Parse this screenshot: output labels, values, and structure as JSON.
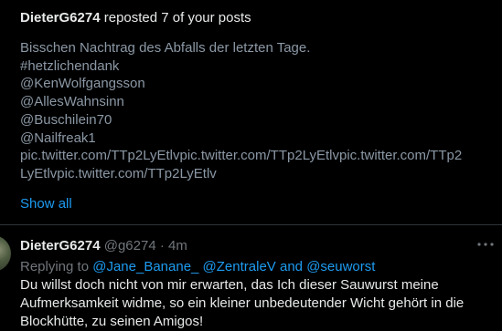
{
  "notification": {
    "user": "DieterG6274",
    "action": "reposted 7 of your posts",
    "preview_lines": [
      "Bisschen Nachtrag  des Abfalls der letzten Tage.",
      "#hetzlichendank",
      "@KenWolfgangsson",
      "@AllesWahnsinn",
      "@Buschilein70",
      "@Nailfreak1",
      "pic.twitter.com/TTp2LyEtlvpic.twitter.com/TTp2LyEtlvpic.twitter.com/TTp2",
      "LyEtlvpic.twitter.com/TTp2LyEtlv"
    ],
    "show_all": "Show all"
  },
  "tweet": {
    "display_name": "DieterG6274",
    "handle": "@g6274",
    "separator": "·",
    "time": "4m",
    "more_icon": "more-horizontal-icon",
    "replying_prefix": "Replying to",
    "mention_1": "@Jane_Banane_",
    "mention_2": "@ZentraleV",
    "and_word": "and",
    "mention_3": "@seuworst",
    "body_lines": [
      "Du willst doch nicht von mir erwarten, das Ich dieser Sauwurst meine",
      "Aufmerksamkeit widme, so ein kleiner unbedeutender Wicht gehört in die",
      "Blockhütte, zu seinen Amigos!"
    ]
  },
  "colors": {
    "background": "#000000",
    "text_primary": "#e7e9ea",
    "text_secondary": "#71767b",
    "preview_text": "#8b98a5",
    "accent": "#1d9bf0",
    "divider": "#2f3336"
  }
}
